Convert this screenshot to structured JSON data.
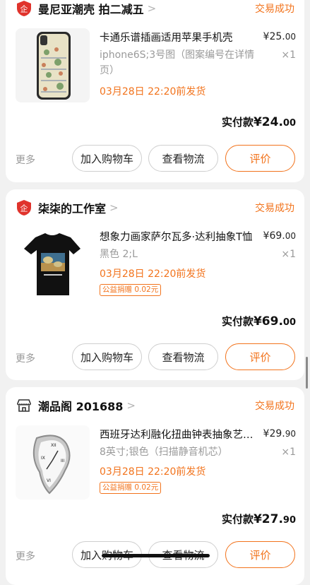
{
  "orders": [
    {
      "shop_name": "曼尼亚潮壳 拍二减五",
      "shop_icon": "enterprise-shop-icon",
      "status": "交易成功",
      "product_title": "卡通乐谱插画适用苹果手机壳",
      "price_main": "¥25.",
      "price_decimal": "00",
      "spec": "iphone6S;3号图（图案编号在详情页）",
      "qty": "×1",
      "ship_text": "03月28日 22:20前发货",
      "charity_badge": "",
      "paid_label": "实付款",
      "paid_main": "¥24.",
      "paid_decimal": "00",
      "more_label": "更多",
      "buttons": [
        "加入购物车",
        "查看物流",
        "评价"
      ]
    },
    {
      "shop_name": "柒柒的工作室",
      "shop_icon": "enterprise-shop-icon",
      "status": "交易成功",
      "product_title": "想象力画家萨尔瓦多·达利抽象T恤",
      "price_main": "¥69.",
      "price_decimal": "00",
      "spec": "黑色 2;L",
      "qty": "×1",
      "ship_text": "03月28日 22:20前发货",
      "charity_badge": "公益捐赠 0.02元",
      "paid_label": "实付款",
      "paid_main": "¥69.",
      "paid_decimal": "00",
      "more_label": "更多",
      "buttons": [
        "加入购物车",
        "查看物流",
        "评价"
      ]
    },
    {
      "shop_name": "潮品阁 201688",
      "shop_icon": "store-icon",
      "status": "交易成功",
      "product_title": "西班牙达利融化扭曲钟表抽象艺术摆件",
      "price_main": "¥29.",
      "price_decimal": "90",
      "spec": "8英寸;银色（扫描静音机芯）",
      "qty": "×1",
      "ship_text": "03月28日 22:20前发货",
      "charity_badge": "公益捐赠 0.02元",
      "paid_label": "实付款",
      "paid_main": "¥27.",
      "paid_decimal": "90",
      "more_label": "更多",
      "buttons": [
        "加入购物车",
        "查看物流",
        "评价"
      ]
    }
  ],
  "colors": {
    "accent": "#f2731c",
    "shop_badge_red": "#e0332c",
    "background": "#f1f1f1"
  }
}
